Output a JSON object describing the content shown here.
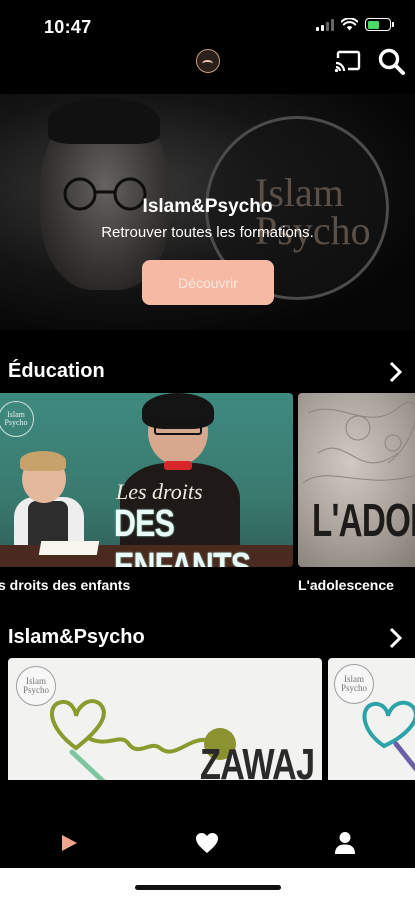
{
  "status_bar": {
    "time": "10:47"
  },
  "hero": {
    "title": "Islam&Psycho",
    "subtitle": "Retrouver toutes les formations.",
    "cta_label": "Découvrir",
    "background_text": "Islam Psycho"
  },
  "sections": [
    {
      "title": "Éducation",
      "cards": [
        {
          "caption": "s droits des enfants",
          "thumb_top": "Les droits",
          "thumb_big": "DES ENFANTS",
          "logo": "Islam Psycho"
        },
        {
          "caption": "L'adolescence",
          "thumb_big": "L'ADOLE"
        }
      ]
    },
    {
      "title": "Islam&Psycho",
      "cards": [
        {
          "thumb_big": "ZAWAJ",
          "logo": "Islam Psycho"
        },
        {
          "logo": "Islam Psycho"
        }
      ]
    }
  ],
  "colors": {
    "background": "#000000",
    "cta": "#f5b9a4",
    "accent_play": "#f3a48c"
  },
  "tabs": [
    {
      "name": "play-icon",
      "active": true
    },
    {
      "name": "heart-icon",
      "active": false
    },
    {
      "name": "person-icon",
      "active": false
    }
  ]
}
